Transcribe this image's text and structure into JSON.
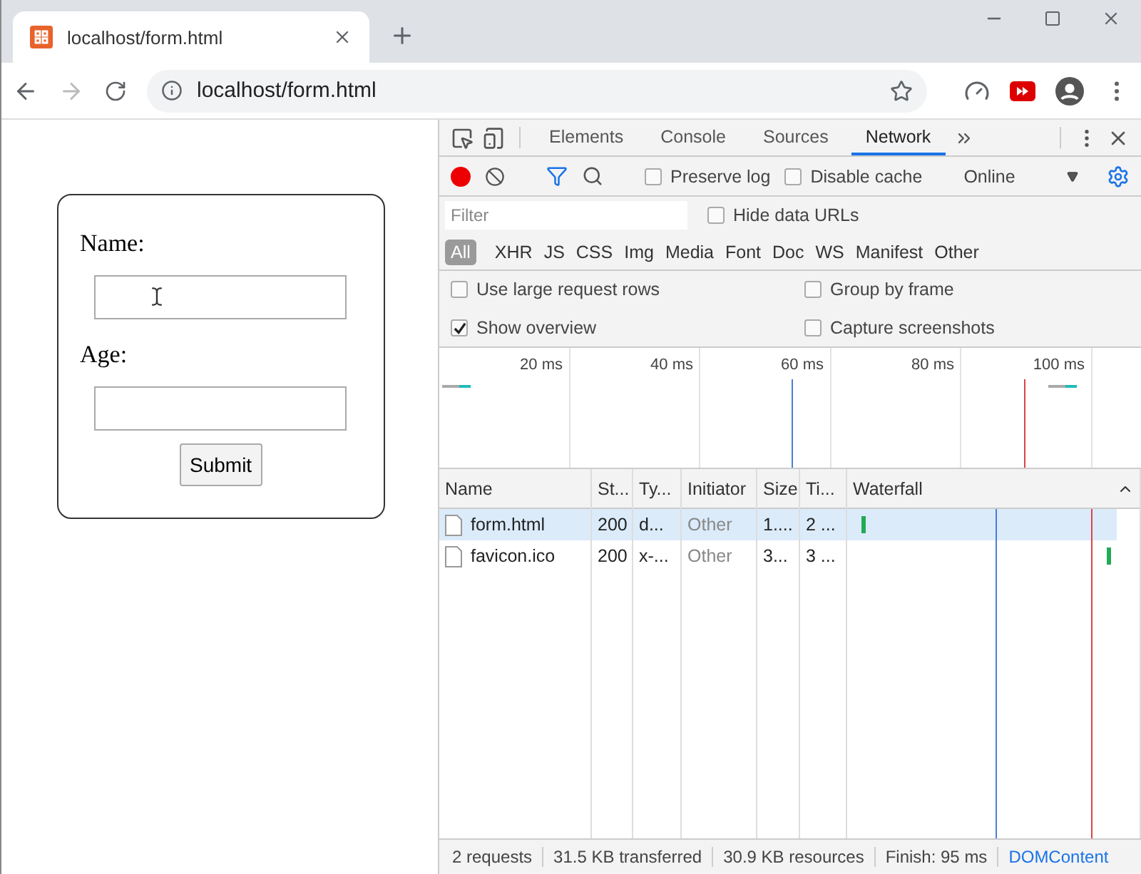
{
  "browser_tab": {
    "title": "localhost/form.html"
  },
  "address_bar": {
    "url": "localhost/form.html"
  },
  "page": {
    "fields": [
      {
        "label": "Name:"
      },
      {
        "label": "Age:"
      }
    ],
    "submit": "Submit"
  },
  "devtools": {
    "tabs": [
      {
        "label": "Elements",
        "selected": false
      },
      {
        "label": "Console",
        "selected": false
      },
      {
        "label": "Sources",
        "selected": false
      },
      {
        "label": "Network",
        "selected": true
      }
    ],
    "toolbar": {
      "recording": true,
      "checks": [
        {
          "label": "Preserve log",
          "checked": false
        },
        {
          "label": "Disable cache",
          "checked": false
        }
      ],
      "throttling": "Online"
    },
    "filter": {
      "placeholder": "Filter",
      "hide_data_urls": {
        "label": "Hide data URLs",
        "checked": false
      }
    },
    "types": [
      {
        "label": "All",
        "selected": true
      },
      {
        "label": "XHR",
        "selected": false
      },
      {
        "label": "JS",
        "selected": false
      },
      {
        "label": "CSS",
        "selected": false
      },
      {
        "label": "Img",
        "selected": false
      },
      {
        "label": "Media",
        "selected": false
      },
      {
        "label": "Font",
        "selected": false
      },
      {
        "label": "Doc",
        "selected": false
      },
      {
        "label": "WS",
        "selected": false
      },
      {
        "label": "Manifest",
        "selected": false
      },
      {
        "label": "Other",
        "selected": false
      }
    ],
    "options": [
      {
        "label": "Use large request rows",
        "checked": false
      },
      {
        "label": "Group by frame",
        "checked": false
      },
      {
        "label": "Show overview",
        "checked": true
      },
      {
        "label": "Capture screenshots",
        "checked": false
      }
    ],
    "overview": {
      "ticks": [
        "20 ms",
        "40 ms",
        "60 ms",
        "80 ms",
        "100 ms"
      ]
    },
    "table": {
      "columns": [
        "Name",
        "St...",
        "Ty...",
        "Initiator",
        "Size",
        "Ti...",
        "Waterfall"
      ],
      "rows": [
        {
          "cells": [
            "form.html",
            "200",
            "d...",
            "Other",
            "1....",
            "2 ..."
          ],
          "selected": true
        },
        {
          "cells": [
            "favicon.ico",
            "200",
            "x-...",
            "Other",
            "3...",
            "3 ..."
          ],
          "selected": false
        }
      ]
    },
    "status_bar": [
      {
        "text": "2 requests",
        "kind": "stat"
      },
      {
        "text": "31.5 KB transferred",
        "kind": "stat"
      },
      {
        "text": "30.9 KB resources",
        "kind": "stat"
      },
      {
        "text": "Finish: 95 ms",
        "kind": "stat"
      },
      {
        "text": "DOMContent",
        "kind": "event"
      }
    ]
  }
}
